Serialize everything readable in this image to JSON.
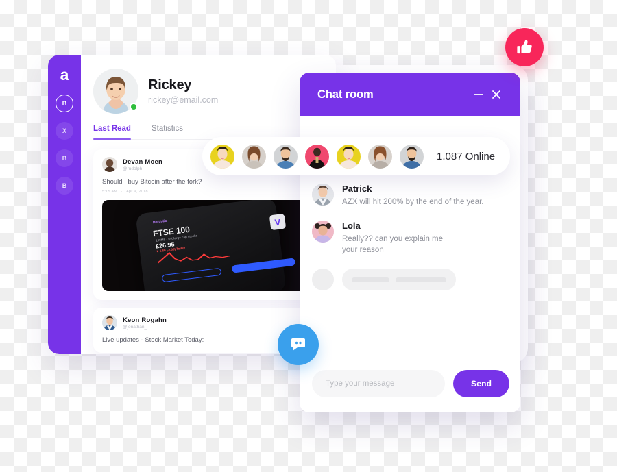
{
  "app": {
    "logo_letter": "a",
    "accent_purple": "#7733e8",
    "accent_blue": "#3aa0ec",
    "accent_red": "#f8265a",
    "status_green": "#2fbe3c"
  },
  "sidebar": {
    "items": [
      {
        "label": "B",
        "name": "sidebar-item-1",
        "active": true
      },
      {
        "label": "X",
        "name": "sidebar-item-2",
        "active": false
      },
      {
        "label": "B",
        "name": "sidebar-item-3",
        "active": false
      },
      {
        "label": "B",
        "name": "sidebar-item-4",
        "active": false
      }
    ]
  },
  "profile": {
    "name": "Rickey",
    "email": "rickey@email.com",
    "status": "online"
  },
  "tabs": [
    {
      "label": "Last Read",
      "active": true
    },
    {
      "label": "Statistics",
      "active": false
    }
  ],
  "feed": {
    "posts": [
      {
        "author": "Devan Moen",
        "handle": "@rudolph_",
        "text": "Should I buy Bitcoin after the fork?",
        "time": "5:15 AM",
        "date": "Apr 9, 2018",
        "separator": "·",
        "photo": {
          "caption": "FTSE 100",
          "subcaption": "100ME - UK large cap stocks",
          "price": "£26.95",
          "change": "▼ 6.60 (-2.08) Today"
        }
      },
      {
        "author": "Keon Rogahn",
        "handle": "@jonathan_",
        "text": "Live updates - Stock Market Today:"
      }
    ]
  },
  "chat": {
    "title": "Chat room",
    "minimize_label": "—",
    "close_label": "✕",
    "messages": [
      {
        "author": "Patrick",
        "text": "AZX will hit 200% by the end of the year.",
        "avatar_bg": "#e4e6ea"
      },
      {
        "author": "Lola",
        "text": "Really?? can you explain me\nyour reason",
        "avatar_bg": "#f0b9c6"
      }
    ],
    "input_placeholder": "Type your message",
    "input_value": "",
    "send_label": "Send"
  },
  "online_pill": {
    "count_label": "1.087 Online",
    "avatars": [
      {
        "name": "avatar-1",
        "bg": "#e8d21f"
      },
      {
        "name": "avatar-2",
        "bg": "#cfc9c4"
      },
      {
        "name": "avatar-3",
        "bg": "#cfd1d2"
      },
      {
        "name": "avatar-4",
        "bg": "#f0486e"
      },
      {
        "name": "avatar-5",
        "bg": "#e8d21f"
      },
      {
        "name": "avatar-6",
        "bg": "#d8d2cc"
      },
      {
        "name": "avatar-7",
        "bg": "#cfd1d2"
      }
    ]
  },
  "floating": {
    "like_icon": "thumbs-up-icon",
    "chat_icon": "chat-bubble-icon"
  }
}
